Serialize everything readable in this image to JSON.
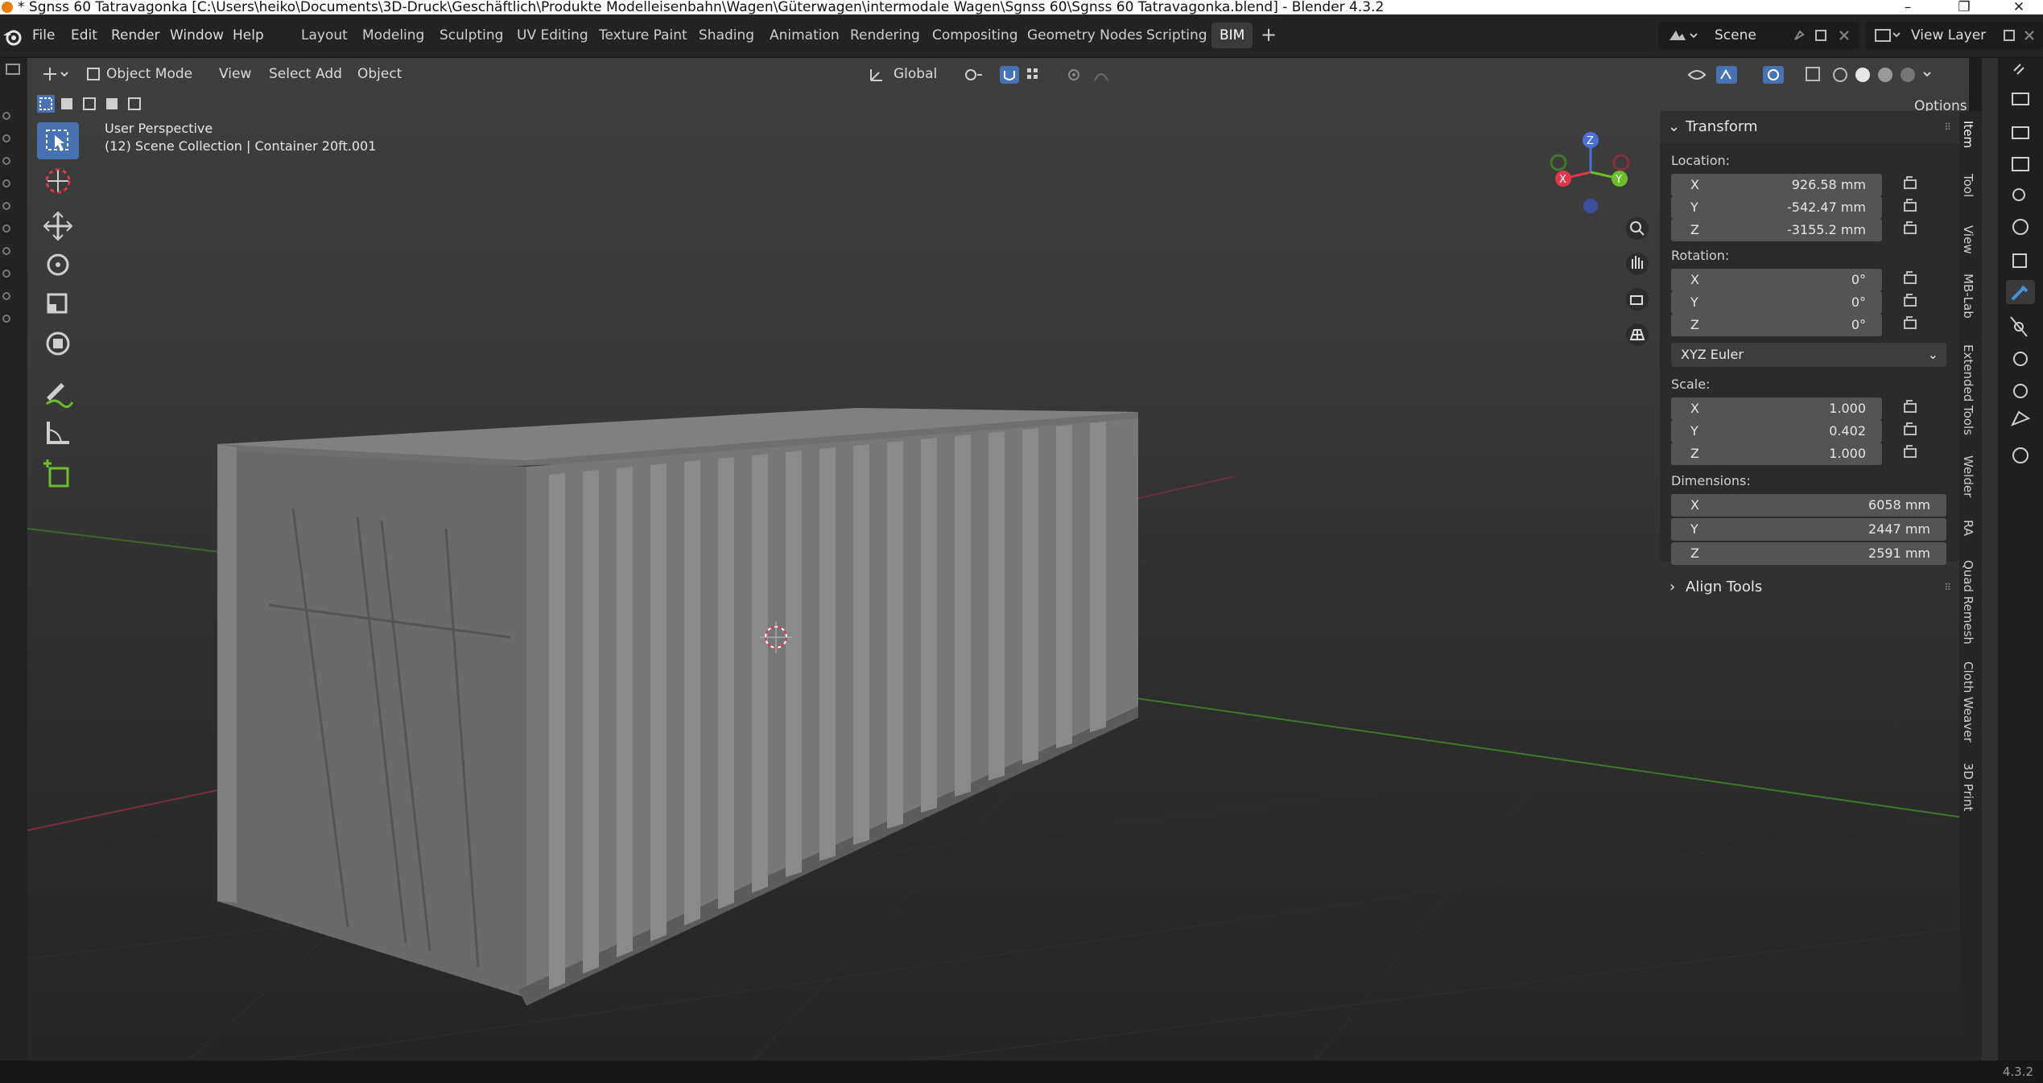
{
  "window": {
    "title": "* Sgnss 60 Tatravagonka [C:\\Users\\heiko\\Documents\\3D-Druck\\Geschäftlich\\Produkte Modelleisenbahn\\Wagen\\Güterwagen\\intermodale Wagen\\Sgnss 60\\Sgnss 60 Tatravagonka.blend] - Blender 4.3.2",
    "controls": [
      "–",
      "❐",
      "✕"
    ]
  },
  "menu": [
    "File",
    "Edit",
    "Render",
    "Window",
    "Help"
  ],
  "workspaces": [
    "Layout",
    "Modeling",
    "Sculpting",
    "UV Editing",
    "Texture Paint",
    "Shading",
    "Animation",
    "Rendering",
    "Compositing",
    "Geometry Nodes",
    "Scripting",
    "BIM"
  ],
  "active_workspace": "BIM",
  "scene": "Scene",
  "view_layer": "View Layer",
  "viewport_header": {
    "mode": "Object Mode",
    "items": [
      "View",
      "Select",
      "Add",
      "Object"
    ],
    "orientation": "Global",
    "options": "Options"
  },
  "viewport": {
    "perspective": "User Perspective",
    "collection": "(12) Scene Collection | Container 20ft.001",
    "gizmo": {
      "x": "X",
      "y": "Y",
      "z": "Z"
    }
  },
  "transform": {
    "title": "Transform",
    "location_label": "Location:",
    "location": [
      {
        "axis": "X",
        "value": "926.58 mm"
      },
      {
        "axis": "Y",
        "value": "-542.47 mm"
      },
      {
        "axis": "Z",
        "value": "-3155.2 mm"
      }
    ],
    "rotation_label": "Rotation:",
    "rotation": [
      {
        "axis": "X",
        "value": "0°"
      },
      {
        "axis": "Y",
        "value": "0°"
      },
      {
        "axis": "Z",
        "value": "0°"
      }
    ],
    "rotation_mode": "XYZ Euler",
    "scale_label": "Scale:",
    "scale": [
      {
        "axis": "X",
        "value": "1.000"
      },
      {
        "axis": "Y",
        "value": "0.402"
      },
      {
        "axis": "Z",
        "value": "1.000"
      }
    ],
    "dimensions_label": "Dimensions:",
    "dimensions": [
      {
        "axis": "X",
        "value": "6058 mm"
      },
      {
        "axis": "Y",
        "value": "2447 mm"
      },
      {
        "axis": "Z",
        "value": "2591 mm"
      }
    ]
  },
  "align_tools": "Align Tools",
  "side_tabs": [
    "Item",
    "Tool",
    "View",
    "MB-Lab",
    "Extended Tools",
    "Welder",
    "RA",
    "Quad Remesh",
    "Cloth Weaver",
    "3D Print"
  ],
  "version": "4.3.2",
  "colors": {
    "accent": "#4772b3",
    "axis_x": "#e0374a",
    "axis_y": "#6bbf2a",
    "axis_z": "#4a6fd8",
    "header": "#232323"
  }
}
